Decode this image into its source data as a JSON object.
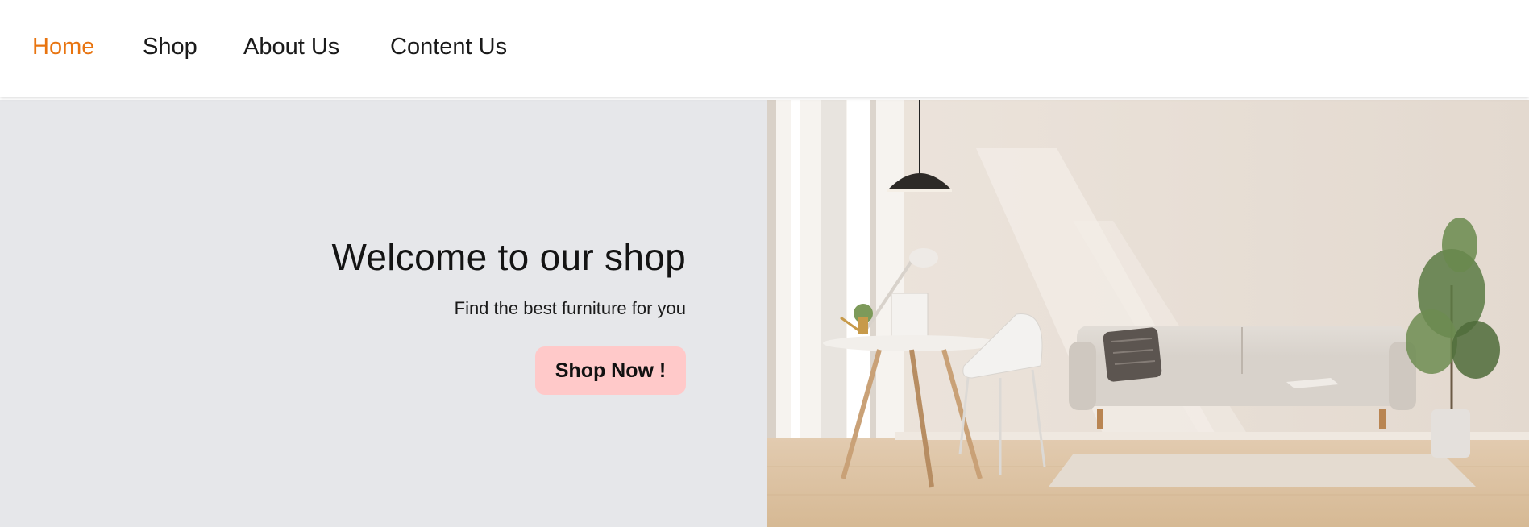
{
  "nav": {
    "items": [
      {
        "label": "Home",
        "active": true
      },
      {
        "label": "Shop",
        "active": false
      },
      {
        "label": "About Us",
        "active": false
      },
      {
        "label": "Content Us",
        "active": false
      }
    ],
    "active_color": "#e87410"
  },
  "hero": {
    "title": "Welcome to our shop",
    "subtitle": "Find the best furniture for you",
    "button_label": "Shop Now !",
    "button_color": "#ffc9c9",
    "panel_color": "#e6e7ea",
    "image_alt": "living-room-furniture-photo"
  }
}
